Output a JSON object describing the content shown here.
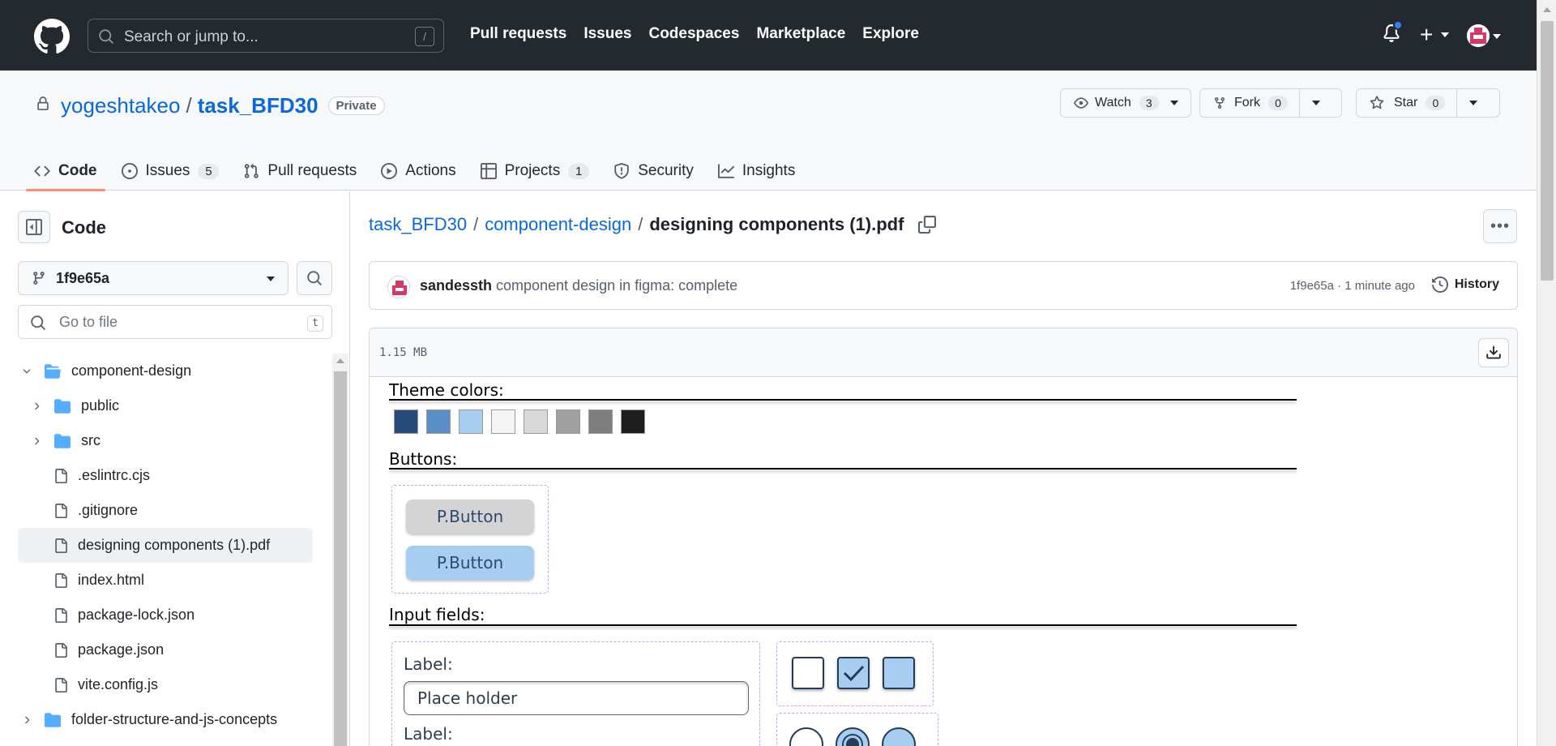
{
  "header": {
    "search_placeholder": "Search or jump to...",
    "search_shortcut": "/",
    "nav": [
      "Pull requests",
      "Issues",
      "Codespaces",
      "Marketplace",
      "Explore"
    ]
  },
  "repo": {
    "owner": "yogeshtakeo",
    "separator": "/",
    "name": "task_BFD30",
    "visibility": "Private",
    "watch": {
      "label": "Watch",
      "count": "3"
    },
    "fork": {
      "label": "Fork",
      "count": "0"
    },
    "star": {
      "label": "Star",
      "count": "0"
    }
  },
  "tabs": [
    {
      "label": "Code",
      "icon": "code-icon"
    },
    {
      "label": "Issues",
      "count": "5",
      "icon": "issue-opened-icon"
    },
    {
      "label": "Pull requests",
      "icon": "git-pull-request-icon"
    },
    {
      "label": "Actions",
      "icon": "play-icon"
    },
    {
      "label": "Projects",
      "count": "1",
      "icon": "table-icon"
    },
    {
      "label": "Security",
      "icon": "shield-icon"
    },
    {
      "label": "Insights",
      "icon": "graph-icon"
    }
  ],
  "sidebar": {
    "title": "Code",
    "branch": "1f9e65a",
    "goto_placeholder": "Go to file",
    "goto_shortcut": "t",
    "tree": [
      {
        "name": "component-design",
        "type": "folder",
        "expanded": true
      },
      {
        "name": "public",
        "type": "folder"
      },
      {
        "name": "src",
        "type": "folder"
      },
      {
        "name": ".eslintrc.cjs",
        "type": "file"
      },
      {
        "name": ".gitignore",
        "type": "file"
      },
      {
        "name": "designing components (1).pdf",
        "type": "file",
        "selected": true
      },
      {
        "name": "index.html",
        "type": "file"
      },
      {
        "name": "package-lock.json",
        "type": "file"
      },
      {
        "name": "package.json",
        "type": "file"
      },
      {
        "name": "vite.config.js",
        "type": "file"
      },
      {
        "name": "folder-structure-and-js-concepts",
        "type": "folder"
      }
    ]
  },
  "breadcrumb": {
    "repo": "task_BFD30",
    "folder": "component-design",
    "file": "designing components (1).pdf",
    "sep": "/"
  },
  "commit": {
    "author": "sandessth",
    "message": "component design in figma: complete",
    "meta": "1f9e65a · 1 minute ago",
    "history_label": "History"
  },
  "file": {
    "size": "1.15 MB"
  },
  "pdf": {
    "theme_title": "Theme colors:",
    "theme_colors": [
      "#264a7a",
      "#5b8fc7",
      "#a7cdf0",
      "#f5f5f5",
      "#d9d9d9",
      "#a0a0a0",
      "#7f7f7f",
      "#1e1e1e"
    ],
    "buttons_title": "Buttons:",
    "button_label": "P.Button",
    "button_colors": [
      "#d4d4d4",
      "#a7cdf0"
    ],
    "inputs_title": "Input fields:",
    "field_label": "Label:",
    "field_placeholder": "Place holder",
    "checkbox_states": [
      false,
      true,
      false
    ]
  }
}
